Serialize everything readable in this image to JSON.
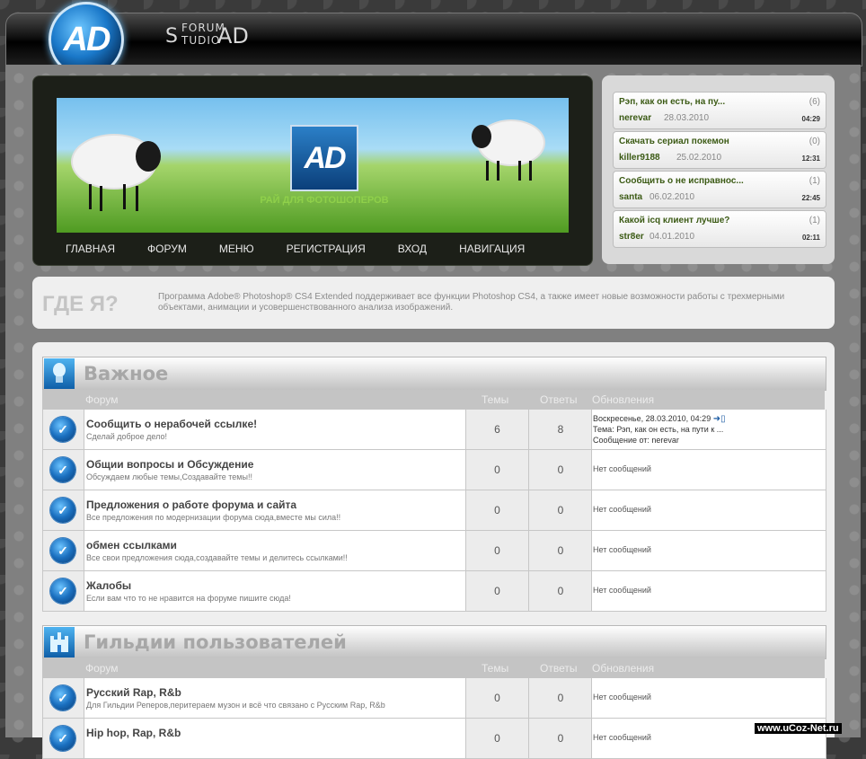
{
  "brand": {
    "logo_letters": "AD",
    "forum_word": "FORUM",
    "studio_word": "TUDIO",
    "studio_initial": "S",
    "ad_word": "AD"
  },
  "banner": {
    "logo_letters": "AD",
    "slogan": "РАЙ ДЛЯ ФОТОШОПЕРОВ"
  },
  "nav": [
    "ГЛАВНАЯ",
    "ФОРУМ",
    "МЕНЮ",
    "РЕГИСТРАЦИЯ",
    "ВХОД",
    "НАВИГАЦИЯ"
  ],
  "recent_topics": [
    {
      "title": "Рэп, как он есть, на пу...",
      "count": "(6)",
      "author": "nerevar",
      "date": "28.03.2010",
      "time": "04:29"
    },
    {
      "title": "Скачать сериал покемон",
      "count": "(0)",
      "author": "killer9188",
      "date": "25.02.2010",
      "time": "12:31"
    },
    {
      "title": "Сообщить о не исправнос...",
      "count": "(1)",
      "author": "santa",
      "date": "06.02.2010",
      "time": "22:45"
    },
    {
      "title": "Какой icq клиент лучше?",
      "count": "(1)",
      "author": "str8er",
      "date": "04.01.2010",
      "time": "02:11"
    }
  ],
  "where_am_i": {
    "title": "ГДЕ Я?",
    "text": "Программа Adobe® Photoshop® CS4 Extended поддерживает все функции Photoshop CS4, а также имеет новые возможности работы с трехмерными объектами, анимации и усовершенствованного анализа изображений."
  },
  "columns": {
    "forum": "Форум",
    "topics": "Темы",
    "answers": "Ответы",
    "updates": "Обновления"
  },
  "categories": [
    {
      "title": "Важное",
      "icon": "lightbulb-icon",
      "forums": [
        {
          "name": "Сообщить о нерабочей ссылке!",
          "desc": "Сделай доброе дело!",
          "topics": "6",
          "answers": "8",
          "update": {
            "date": "Воскресенье, 28.03.2010, 04:29",
            "topic": "Тема: Рэп, как он есть, на пути к ...",
            "author": "Сообщение от: nerevar"
          }
        },
        {
          "name": "Общии вопросы и Обсуждение",
          "desc": "Обсуждаем любые темы,Создавайте темы!!",
          "topics": "0",
          "answers": "0",
          "none": "Нет сообщений"
        },
        {
          "name": "Предложения о работе форума и сайта",
          "desc": "Все предложения по модернизации форума сюда,вместе мы сила!!",
          "topics": "0",
          "answers": "0",
          "none": "Нет сообщений"
        },
        {
          "name": "обмен ссылками",
          "desc": "Все свои предложения сюда,создавайте темы и делитесь ссылками!!",
          "topics": "0",
          "answers": "0",
          "none": "Нет сообщений"
        },
        {
          "name": "Жалобы",
          "desc": "Если вам что то не нравится на форуме пишите сюда!",
          "topics": "0",
          "answers": "0",
          "none": "Нет сообщений"
        }
      ]
    },
    {
      "title": "Гильдии пользователей",
      "icon": "castle-icon",
      "forums": [
        {
          "name": "Русский Rap, R&b",
          "desc": "Для Гильдии Реперов,перитераем музон и всё что связано с Русским Rap, R&b",
          "topics": "0",
          "answers": "0",
          "none": "Нет сообщений"
        },
        {
          "name": "Hip hop, Rap, R&b",
          "desc": "",
          "topics": "0",
          "answers": "0",
          "none": "Нет сообщений"
        }
      ]
    }
  ],
  "watermark": "www.uCoz-Net.ru"
}
